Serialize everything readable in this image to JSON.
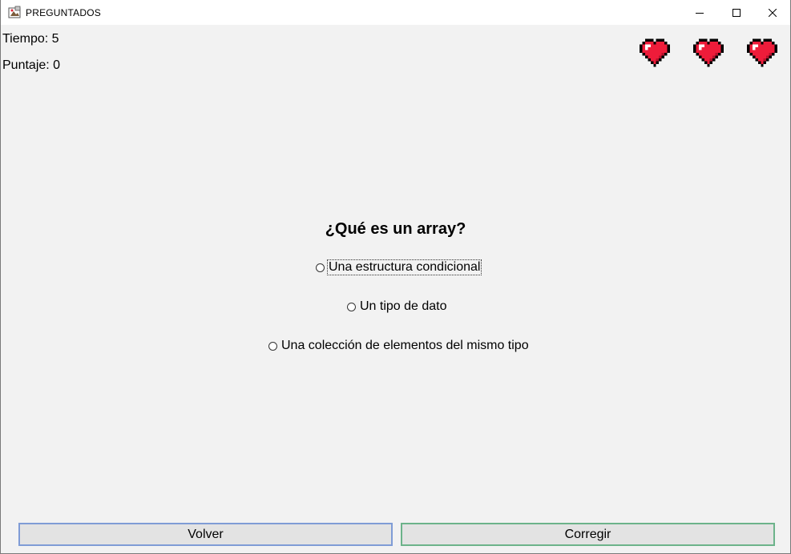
{
  "window": {
    "title": "PREGUNTADOS"
  },
  "stats": {
    "tiempo_label": "Tiempo: ",
    "tiempo_value": "5",
    "puntaje_label": "Puntaje: ",
    "puntaje_value": "0"
  },
  "lives": {
    "count": 3,
    "icon": "heart-icon",
    "color": "#ee1c3a"
  },
  "question": {
    "text": "¿Qué es un array?",
    "options": [
      {
        "label": "Una estructura condicional",
        "selected": false,
        "focused": true
      },
      {
        "label": "Un tipo de dato",
        "selected": false,
        "focused": false
      },
      {
        "label": "Una colección de elementos del mismo tipo",
        "selected": false,
        "focused": false
      }
    ]
  },
  "buttons": {
    "volver": "Volver",
    "corregir": "Corregir"
  },
  "colors": {
    "background": "#f2f2f2",
    "volver_border": "#7f9cd6",
    "corregir_border": "#6cb38a"
  }
}
